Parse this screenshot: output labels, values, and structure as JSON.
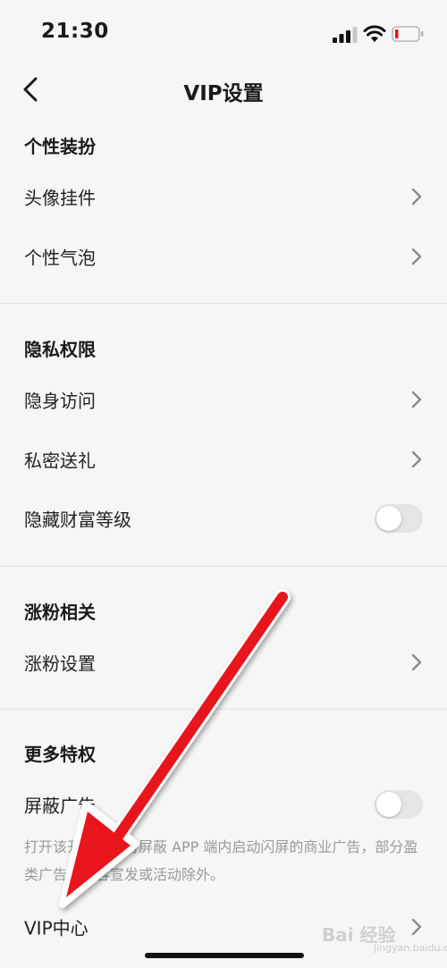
{
  "status_bar": {
    "time": "21:30"
  },
  "header": {
    "title": "VIP设置"
  },
  "sections": [
    {
      "title": "个性装扮",
      "items": [
        {
          "label": "头像挂件"
        },
        {
          "label": "个性气泡"
        }
      ]
    },
    {
      "title": "隐私权限",
      "items": [
        {
          "label": "隐身访问"
        },
        {
          "label": "私密送礼"
        },
        {
          "label": "隐藏财富等级",
          "toggle": false
        }
      ]
    },
    {
      "title": "涨粉相关",
      "items": [
        {
          "label": "涨粉设置"
        }
      ]
    },
    {
      "title": "更多特权",
      "items": [
        {
          "label": "屏蔽广告",
          "toggle": false
        },
        {
          "label": "VIP中心"
        }
      ]
    }
  ],
  "ad_block_note": "打开该开关后，将屏蔽 APP 端内启动闪屏的商业广告，部分盈类广告，内容宣发或活动除外。",
  "watermark": {
    "text": "Bai 经验",
    "sub": "jingyan.baidu.com"
  },
  "colors": {
    "background": "#f6f6f6",
    "toggle_off": "#e5e5e5",
    "arrow": "#e8141c"
  }
}
